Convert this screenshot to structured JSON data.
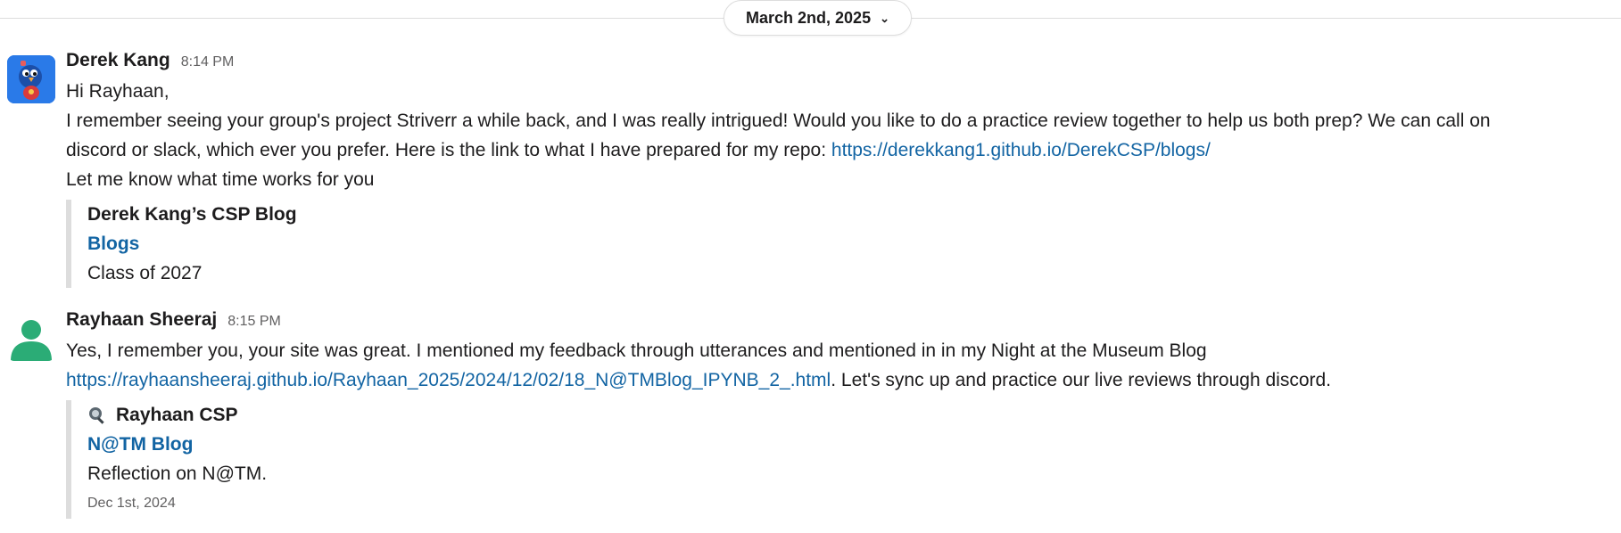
{
  "date_divider": {
    "label": "March 2nd, 2025",
    "chevron_icon": "chevron-down-icon"
  },
  "messages": [
    {
      "author": "Derek Kang",
      "time": "8:14 PM",
      "lines": [
        "Hi Rayhaan,",
        "I remember seeing your group's project Striverr a while back, and I was really intrigued! Would you like to do a practice review together to help us both prep? We can call on",
        "discord or slack, which ever you prefer. Here is the link to what I have prepared for my repo: ",
        "Let me know what time works for you"
      ],
      "link": "https://derekkang1.github.io/DerekCSP/blogs/",
      "unfurl": {
        "site": "Derek Kang’s CSP Blog",
        "title": "Blogs",
        "description": "Class of 2027"
      }
    },
    {
      "author": "Rayhaan Sheeraj",
      "time": "8:15 PM",
      "lines": [
        "Yes, I remember you, your site was great. I mentioned my feedback through utterances and mentioned in in my Night at the Museum Blog",
        ". Let's sync up and practice our live reviews through discord."
      ],
      "link": "https://rayhaansheeraj.github.io/Rayhaan_2025/2024/12/02/18_N@TMBlog_IPYNB_2_.html",
      "unfurl": {
        "site": "Rayhaan CSP",
        "site_icon": "magnifier-robot-icon",
        "title": "N@TM Blog",
        "description": "Reflection on N@TM.",
        "date": "Dec 1st, 2024"
      }
    }
  ],
  "colors": {
    "link": "#1264a3",
    "avatar_green": "#2bac76",
    "avatar_blue": "#1a5fd6"
  }
}
